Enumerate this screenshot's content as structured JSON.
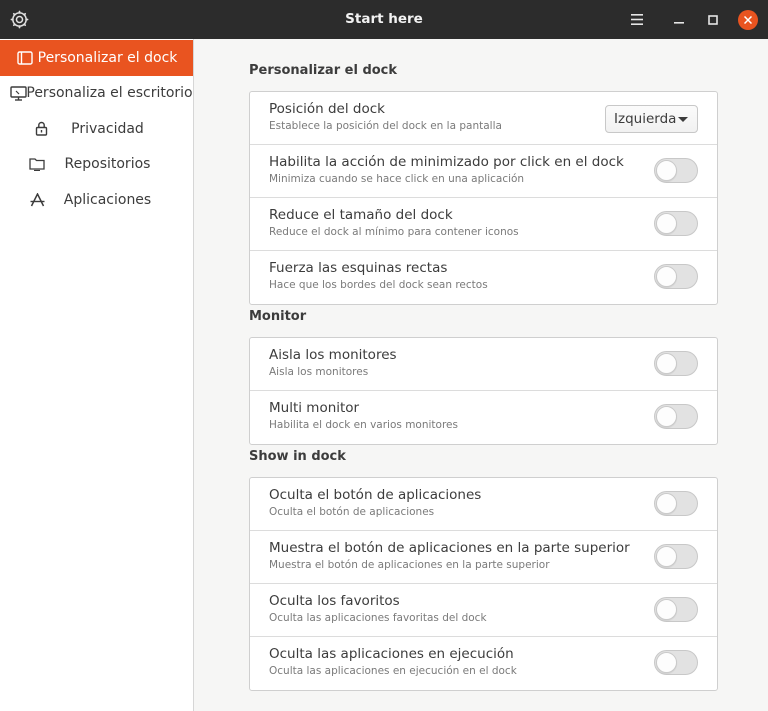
{
  "window": {
    "title": "Start here"
  },
  "colors": {
    "accent": "#e95420",
    "titlebar": "#2c2c2c"
  },
  "sidebar": {
    "items": [
      {
        "label": "Personalizar el dock",
        "icon": "dock-icon",
        "active": true
      },
      {
        "label": "Personaliza el escritorio",
        "icon": "monitor-icon",
        "active": false
      },
      {
        "label": "Privacidad",
        "icon": "lock-icon",
        "active": false
      },
      {
        "label": "Repositorios",
        "icon": "folder-icon",
        "active": false
      },
      {
        "label": "Aplicaciones",
        "icon": "applications-icon",
        "active": false
      }
    ]
  },
  "sections": [
    {
      "title": "Personalizar el dock",
      "rows": [
        {
          "title": "Posición del dock",
          "subtitle": "Establece la posición del dock en la pantalla",
          "control": "dropdown",
          "value": "Izquierda"
        },
        {
          "title": "Habilita la acción de minimizado por click en el dock",
          "subtitle": "Minimiza cuando se hace click en una aplicación",
          "control": "toggle",
          "value": false
        },
        {
          "title": "Reduce el tamaño del dock",
          "subtitle": "Reduce el dock al mínimo para contener iconos",
          "control": "toggle",
          "value": false
        },
        {
          "title": "Fuerza las esquinas rectas",
          "subtitle": "Hace que los bordes del dock sean rectos",
          "control": "toggle",
          "value": false
        }
      ]
    },
    {
      "title": "Monitor",
      "rows": [
        {
          "title": "Aisla los monitores",
          "subtitle": "Aisla los monitores",
          "control": "toggle",
          "value": false
        },
        {
          "title": "Multi monitor",
          "subtitle": "Habilita el dock en varios monitores",
          "control": "toggle",
          "value": false
        }
      ]
    },
    {
      "title": "Show in dock",
      "rows": [
        {
          "title": "Oculta el botón de aplicaciones",
          "subtitle": "Oculta el botón de aplicaciones",
          "control": "toggle",
          "value": false
        },
        {
          "title": "Muestra el botón de aplicaciones en la parte superior",
          "subtitle": "Muestra el botón de aplicaciones en la parte superior",
          "control": "toggle",
          "value": false
        },
        {
          "title": "Oculta los favoritos",
          "subtitle": "Oculta las aplicaciones favoritas del dock",
          "control": "toggle",
          "value": false
        },
        {
          "title": "Oculta las aplicaciones en ejecución",
          "subtitle": "Oculta las aplicaciones en ejecución en el dock",
          "control": "toggle",
          "value": false
        }
      ]
    }
  ]
}
